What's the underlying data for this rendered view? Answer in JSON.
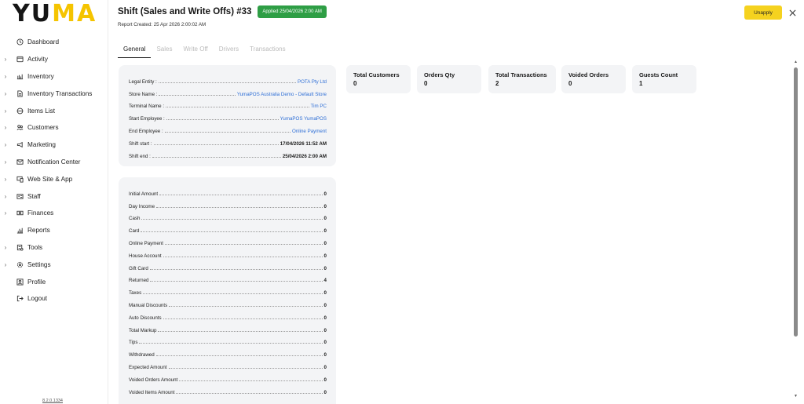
{
  "brand": {
    "logo_part1": "YU",
    "logo_part2": "MA",
    "accent": "#f5c400"
  },
  "sidebar": {
    "items": [
      {
        "label": "Dashboard",
        "icon": "clock-icon",
        "expandable": false
      },
      {
        "label": "Activity",
        "icon": "receipt-icon",
        "expandable": true
      },
      {
        "label": "Inventory",
        "icon": "inventory-icon",
        "expandable": true
      },
      {
        "label": "Inventory Transactions",
        "icon": "document-icon",
        "expandable": true
      },
      {
        "label": "Items List",
        "icon": "items-icon",
        "expandable": true
      },
      {
        "label": "Customers",
        "icon": "customers-icon",
        "expandable": true
      },
      {
        "label": "Marketing",
        "icon": "megaphone-icon",
        "expandable": true
      },
      {
        "label": "Notification Center",
        "icon": "mail-icon",
        "expandable": true
      },
      {
        "label": "Web Site & App",
        "icon": "devices-icon",
        "expandable": true
      },
      {
        "label": "Staff",
        "icon": "id-card-icon",
        "expandable": true
      },
      {
        "label": "Finances",
        "icon": "cash-icon",
        "expandable": true
      },
      {
        "label": "Reports",
        "icon": "bar-chart-icon",
        "expandable": false
      },
      {
        "label": "Tools",
        "icon": "tools-icon",
        "expandable": true
      },
      {
        "label": "Settings",
        "icon": "gear-icon",
        "expandable": true
      },
      {
        "label": "Profile",
        "icon": "profile-icon",
        "expandable": false
      },
      {
        "label": "Logout",
        "icon": "logout-icon",
        "expandable": false
      }
    ],
    "version": "8.2.0.1334"
  },
  "header": {
    "title": "Shift (Sales and Write Offs) #33",
    "badge": "Applied 25/04/2026 2:00 AM",
    "badge_color": "#2e9e45",
    "subtitle": "Report Created: 25 Apr 2026 2:00:02 AM",
    "unapply_label": "Unapply",
    "unapply_color": "#f5d21f"
  },
  "tabs": [
    {
      "label": "General",
      "active": true
    },
    {
      "label": "Sales",
      "active": false
    },
    {
      "label": "Write Off",
      "active": false
    },
    {
      "label": "Drivers",
      "active": false
    },
    {
      "label": "Transactions",
      "active": false
    }
  ],
  "info": [
    {
      "label": "Legal Entity :",
      "value": "POTA Pty Ltd",
      "style": "link"
    },
    {
      "label": "Store Name :",
      "value": "YumaPOS Australia Demo - Default Store",
      "style": "link"
    },
    {
      "label": "Terminal Name :",
      "value": "Tim PC",
      "style": "link"
    },
    {
      "label": "Start Employee :",
      "value": "YumaPOS YumaPOS",
      "style": "link"
    },
    {
      "label": "End Employee :",
      "value": "Online Payment",
      "style": "link"
    },
    {
      "label": "Shift start :",
      "value": "17/04/2026 11:52 AM",
      "style": "bold"
    },
    {
      "label": "Shift end :",
      "value": "25/04/2026 2:00 AM",
      "style": "bold"
    }
  ],
  "stats": [
    {
      "label": "Total Customers",
      "value": "0"
    },
    {
      "label": "Orders Qty",
      "value": "0"
    },
    {
      "label": "Total Transactions",
      "value": "2"
    },
    {
      "label": "Voided Orders",
      "value": "0"
    },
    {
      "label": "Guests Count",
      "value": "1"
    }
  ],
  "amounts": [
    {
      "label": "Initial Amount",
      "value": "0"
    },
    {
      "label": "Day Income",
      "value": "0"
    },
    {
      "label": "Cash",
      "value": "0"
    },
    {
      "label": "Card",
      "value": "0"
    },
    {
      "label": "Online Payment",
      "value": "0"
    },
    {
      "label": "House Account",
      "value": "0"
    },
    {
      "label": "Gift Card",
      "value": "0"
    },
    {
      "label": "Returned",
      "value": "4"
    },
    {
      "label": "Taxes",
      "value": "0"
    },
    {
      "label": "Manual Discounts",
      "value": "0"
    },
    {
      "label": "Auto Discounts",
      "value": "0"
    },
    {
      "label": "Total Markup",
      "value": "0"
    },
    {
      "label": "Tips",
      "value": "0"
    },
    {
      "label": "Withdrawed",
      "value": "0"
    },
    {
      "label": "Expected Amount",
      "value": "0"
    },
    {
      "label": "Voided Orders Amount",
      "value": "0"
    },
    {
      "label": "Voided Items Amount",
      "value": "0"
    }
  ]
}
